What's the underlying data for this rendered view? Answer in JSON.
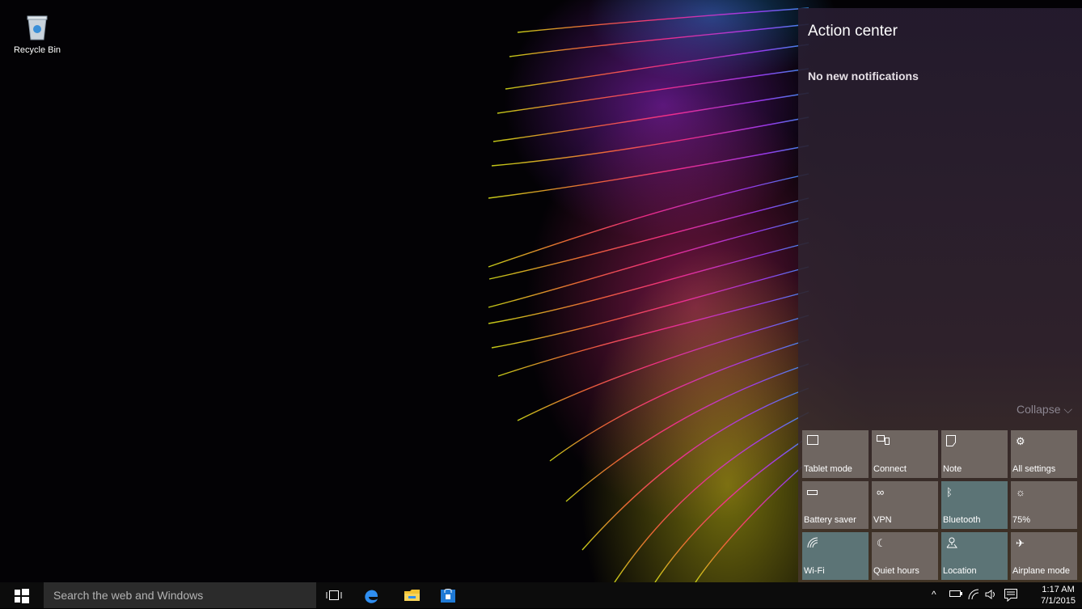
{
  "desktop": {
    "icons": [
      {
        "label": "Recycle Bin",
        "icon": "recycle-bin-icon"
      }
    ]
  },
  "action_center": {
    "title": "Action center",
    "empty_message": "No new notifications",
    "collapse_label": "Collapse ⌵",
    "tiles": [
      {
        "label": "Tablet mode",
        "icon": "tablet-mode-icon",
        "active": false
      },
      {
        "label": "Connect",
        "icon": "connect-icon",
        "active": false
      },
      {
        "label": "Note",
        "icon": "note-icon",
        "active": false
      },
      {
        "label": "All settings",
        "icon": "gear-icon",
        "active": false
      },
      {
        "label": "Battery saver",
        "icon": "battery-icon",
        "active": false
      },
      {
        "label": "VPN",
        "icon": "vpn-icon",
        "active": false
      },
      {
        "label": "Bluetooth",
        "icon": "bluetooth-icon",
        "active": true
      },
      {
        "label": "75%",
        "icon": "brightness-icon",
        "active": false
      },
      {
        "label": "Wi-Fi",
        "icon": "wifi-icon",
        "active": true
      },
      {
        "label": "Quiet hours",
        "icon": "moon-icon",
        "active": false
      },
      {
        "label": "Location",
        "icon": "location-icon",
        "active": true
      },
      {
        "label": "Airplane mode",
        "icon": "airplane-icon",
        "active": false
      }
    ]
  },
  "taskbar": {
    "search_placeholder": "Search the web and Windows",
    "pinned": [
      "task-view-icon",
      "edge-icon",
      "file-explorer-icon",
      "store-icon"
    ],
    "tray": {
      "time": "1:17 AM",
      "date": "7/1/2015"
    }
  },
  "colors": {
    "tile_default": "#6f6661",
    "tile_active": "#5c7476",
    "taskbar": "#0c0c0c",
    "search_box": "#2b2b2b"
  }
}
